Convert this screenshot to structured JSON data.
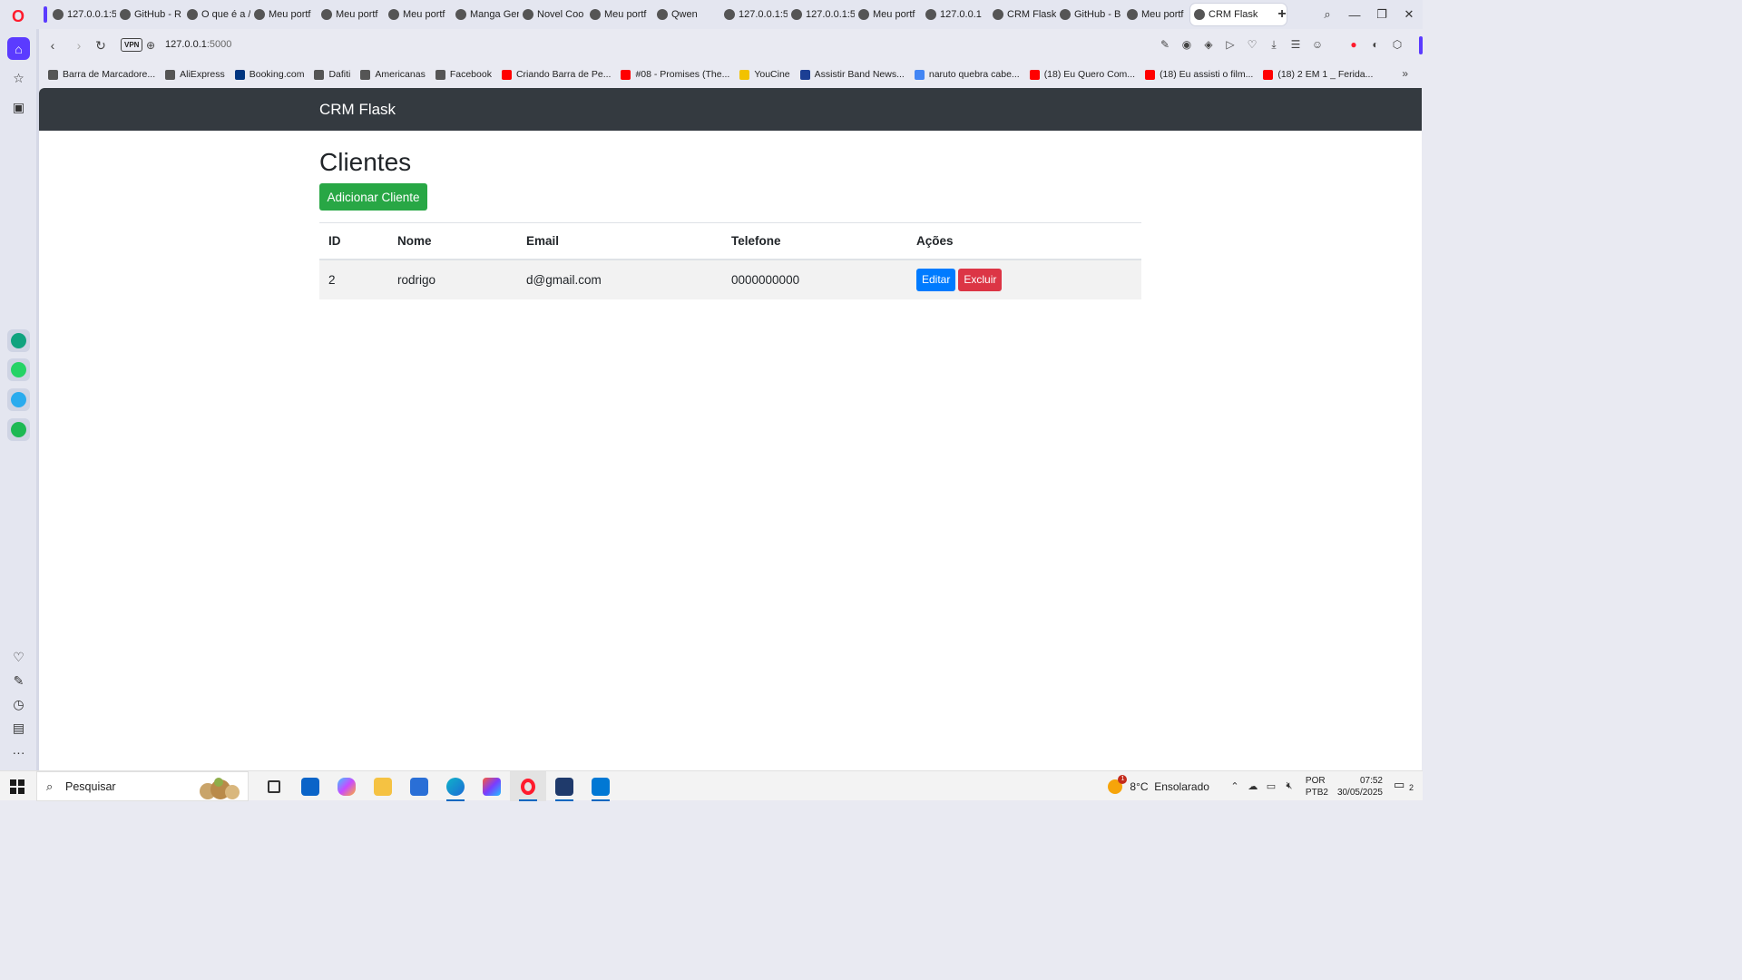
{
  "browser": {
    "tabs": [
      {
        "label": "127.0.0.1:5(",
        "icon": "globe-icon"
      },
      {
        "label": "GitHub - R",
        "icon": "github-icon"
      },
      {
        "label": "O que é a /",
        "icon": "google-icon"
      },
      {
        "label": "Meu portf",
        "icon": "globe-icon"
      },
      {
        "label": "Meu portf",
        "icon": "globe-icon"
      },
      {
        "label": "Meu portf",
        "icon": "globe-icon"
      },
      {
        "label": "Manga Ger",
        "icon": "manga-icon"
      },
      {
        "label": "Novel Coo",
        "icon": "novel-icon"
      },
      {
        "label": "Meu portf",
        "icon": "globe-icon"
      },
      {
        "label": "Qwen",
        "icon": "qwen-icon"
      },
      {
        "label": "127.0.0.1:5",
        "icon": "globe-icon"
      },
      {
        "label": "127.0.0.1:5",
        "icon": "globe-icon"
      },
      {
        "label": "Meu portf",
        "icon": "globe-icon"
      },
      {
        "label": "127.0.0.1",
        "icon": "terminal-icon"
      },
      {
        "label": "CRM Flask",
        "icon": "globe-icon"
      },
      {
        "label": "GitHub - B",
        "icon": "github-icon"
      },
      {
        "label": "Meu portf",
        "icon": "globe-icon"
      },
      {
        "label": "CRM Flask",
        "icon": "globe-icon",
        "active": true
      }
    ],
    "new_tab": "+",
    "address": {
      "vpn": "VPN",
      "host": "127.0.0.1",
      "port": ":5000"
    },
    "bookmarks": [
      {
        "label": "Barra de Marcadore...",
        "color": "#555555"
      },
      {
        "label": "AliExpress",
        "color": "#555555"
      },
      {
        "label": "Booking.com",
        "color": "#003580"
      },
      {
        "label": "Dafiti",
        "color": "#555555"
      },
      {
        "label": "Americanas",
        "color": "#555555"
      },
      {
        "label": "Facebook",
        "color": "#555555"
      },
      {
        "label": "Criando Barra de Pe...",
        "color": "#ff0000"
      },
      {
        "label": "#08 - Promises (The...",
        "color": "#ff0000"
      },
      {
        "label": "YouCine",
        "color": "#f2c200"
      },
      {
        "label": "Assistir Band News...",
        "color": "#1c3f94"
      },
      {
        "label": "naruto quebra cabe...",
        "color": "#4285f4"
      },
      {
        "label": "(18) Eu Quero Com...",
        "color": "#ff0000"
      },
      {
        "label": "(18) Eu assisti o film...",
        "color": "#ff0000"
      },
      {
        "label": "(18) 2 EM 1 _ Ferida...",
        "color": "#ff0000"
      }
    ]
  },
  "app": {
    "brand": "CRM Flask",
    "title": "Clientes",
    "add_button": "Adicionar Cliente",
    "table": {
      "headers": [
        "ID",
        "Nome",
        "Email",
        "Telefone",
        "Ações"
      ],
      "rows": [
        {
          "id": "2",
          "nome": "rodrigo",
          "email": "d@gmail.com",
          "telefone": "0000000000",
          "edit": "Editar",
          "delete": "Excluir"
        }
      ]
    },
    "colors": {
      "navbar": "#343a40",
      "add": "#28a745",
      "edit": "#007bff",
      "delete": "#dc3545"
    }
  },
  "taskbar": {
    "search_placeholder": "Pesquisar",
    "weather": {
      "temp": "8°C",
      "desc": "Ensolarado",
      "alerts": "1"
    },
    "lang": {
      "line1": "POR",
      "line2": "PTB2"
    },
    "clock": {
      "time": "07:52",
      "date": "30/05/2025"
    },
    "notifications": "2"
  }
}
